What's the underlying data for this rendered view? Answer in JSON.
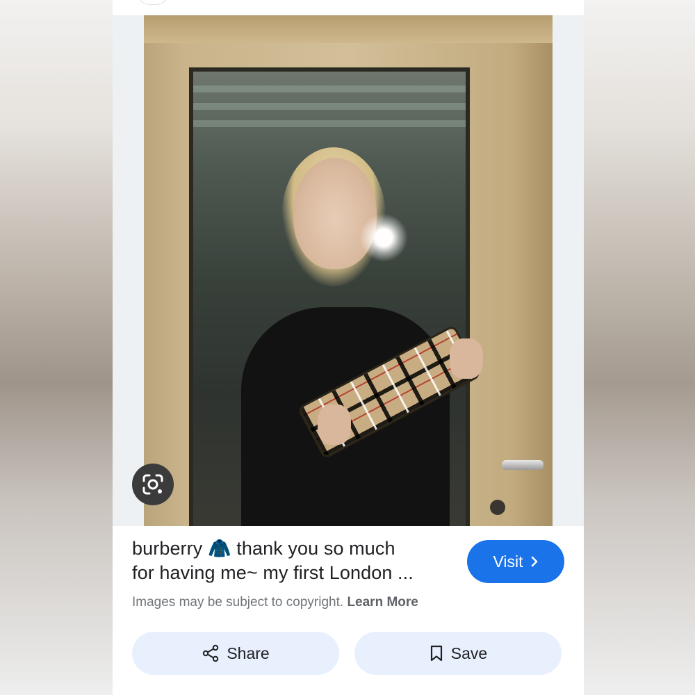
{
  "result": {
    "title_line1": "burberry 🧥 thank you so much",
    "title_line2": "for having me~ my first London ...",
    "copyright_text": "Images may be subject to copyright.",
    "learn_more": "Learn More"
  },
  "actions": {
    "visit_label": "Visit",
    "share_label": "Share",
    "save_label": "Save"
  },
  "icons": {
    "lens": "google-lens-icon",
    "chevron": "chevron-right-icon",
    "share": "share-icon",
    "save": "bookmark-icon"
  },
  "colors": {
    "accent": "#1a73e8",
    "pill_bg": "#e8f0fe",
    "text": "#202124",
    "muted": "#70757a"
  }
}
